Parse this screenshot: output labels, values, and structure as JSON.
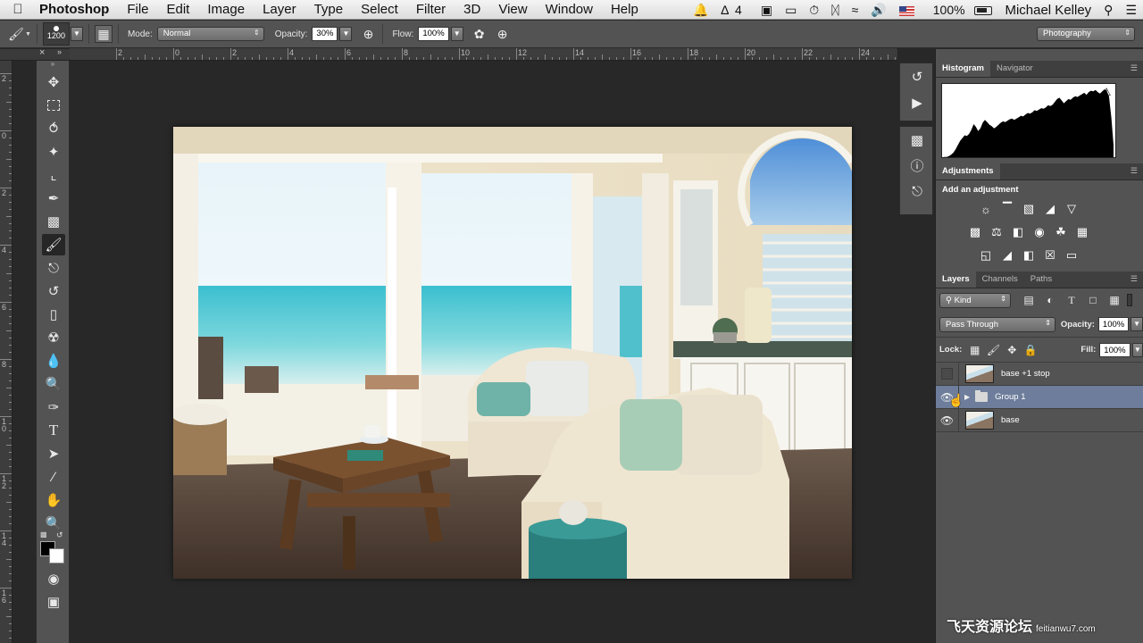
{
  "menubar": {
    "app_name": "Photoshop",
    "items": [
      "File",
      "Edit",
      "Image",
      "Layer",
      "Type",
      "Select",
      "Filter",
      "3D",
      "View",
      "Window",
      "Help"
    ],
    "status_adobe_count": "4",
    "battery": "100%",
    "user": "Michael Kelley"
  },
  "options": {
    "brush_size": "1200",
    "mode_label": "Mode:",
    "mode_value": "Normal",
    "opacity_label": "Opacity:",
    "opacity_value": "30%",
    "flow_label": "Flow:",
    "flow_value": "100%",
    "workspace": "Photography"
  },
  "rulers": {
    "horizontal": [
      "2",
      "0",
      "2",
      "4",
      "6",
      "8",
      "10",
      "12",
      "14",
      "16",
      "18",
      "20",
      "22",
      "24"
    ],
    "vertical": [
      "2",
      "0",
      "2",
      "4",
      "6",
      "8",
      "1\n0",
      "1\n2",
      "1\n4",
      "1\n6"
    ]
  },
  "panels": {
    "histogram_tabs": [
      "Histogram",
      "Navigator"
    ],
    "adjustments_tab": "Adjustments",
    "adjustments_title": "Add an adjustment",
    "layers_tabs": [
      "Layers",
      "Channels",
      "Paths"
    ],
    "kind_filter": "Kind",
    "blend_mode": "Pass Through",
    "opacity_label": "Opacity:",
    "opacity_value": "100%",
    "lock_label": "Lock:",
    "fill_label": "Fill:",
    "fill_value": "100%"
  },
  "layers": [
    {
      "name": "base +1 stop",
      "visible": false,
      "type": "image"
    },
    {
      "name": "Group 1",
      "visible": true,
      "type": "group",
      "selected": true
    },
    {
      "name": "base",
      "visible": true,
      "type": "image"
    }
  ],
  "watermark": {
    "text": "飞天资源论坛",
    "url": "feitianwu7.com"
  },
  "histogram_profile": [
    2,
    3,
    3,
    4,
    6,
    9,
    14,
    20,
    26,
    30,
    34,
    33,
    36,
    42,
    50,
    46,
    40,
    44,
    52,
    56,
    53,
    49,
    47,
    44,
    46,
    49,
    52,
    54,
    53,
    55,
    57,
    58,
    56,
    58,
    60,
    62,
    61,
    64,
    66,
    65,
    67,
    70,
    69,
    71,
    73,
    72,
    74,
    77,
    76,
    78,
    82,
    86,
    88,
    84,
    80,
    83,
    86,
    85,
    88,
    90,
    89,
    91,
    93,
    95,
    92,
    96,
    98,
    97,
    99,
    96,
    94,
    97,
    100,
    98,
    90,
    60,
    20
  ]
}
